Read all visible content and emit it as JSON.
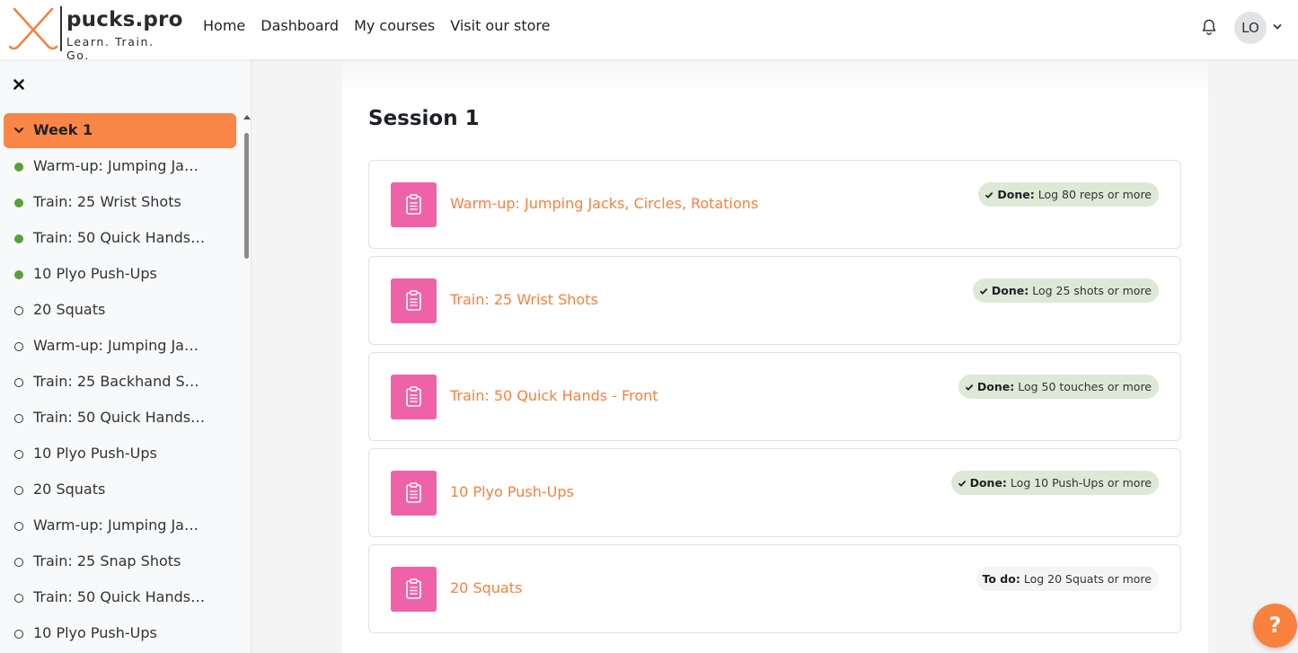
{
  "brand": {
    "name": "pucks.pro",
    "tagline": "Learn. Train. Go."
  },
  "nav": [
    "Home",
    "Dashboard",
    "My courses",
    "Visit our store"
  ],
  "user": {
    "initials": "LO"
  },
  "sidebar": {
    "section": "Week 1",
    "items": [
      {
        "label": "Warm-up: Jumping Jac...",
        "status": "done"
      },
      {
        "label": "Train: 25 Wrist Shots",
        "status": "done"
      },
      {
        "label": "Train: 50 Quick Hands - ...",
        "status": "done"
      },
      {
        "label": "10 Plyo Push-Ups",
        "status": "done"
      },
      {
        "label": "20 Squats",
        "status": "todo"
      },
      {
        "label": "Warm-up: Jumping Jac...",
        "status": "todo"
      },
      {
        "label": "Train: 25 Backhand Shot...",
        "status": "todo"
      },
      {
        "label": "Train: 50 Quick Hands - ...",
        "status": "todo"
      },
      {
        "label": "10 Plyo Push-Ups",
        "status": "todo"
      },
      {
        "label": "20 Squats",
        "status": "todo"
      },
      {
        "label": "Warm-up: Jumping Jac...",
        "status": "todo"
      },
      {
        "label": "Train: 25 Snap Shots",
        "status": "todo"
      },
      {
        "label": "Train: 50 Quick Hands - ...",
        "status": "todo"
      },
      {
        "label": "10 Plyo Push-Ups",
        "status": "todo"
      }
    ]
  },
  "main": {
    "title": "Session 1",
    "activities": [
      {
        "name": "Warm-up: Jumping Jacks, Circles, Rotations",
        "status": "done",
        "status_label": "Done:",
        "requirement": "Log 80 reps or more"
      },
      {
        "name": "Train: 25 Wrist Shots",
        "status": "done",
        "status_label": "Done:",
        "requirement": "Log 25 shots or more"
      },
      {
        "name": "Train: 50 Quick Hands - Front",
        "status": "done",
        "status_label": "Done:",
        "requirement": "Log 50 touches or more"
      },
      {
        "name": "10 Plyo Push-Ups",
        "status": "done",
        "status_label": "Done:",
        "requirement": "Log 10 Push-Ups or more"
      },
      {
        "name": "20 Squats",
        "status": "todo",
        "status_label": "To do:",
        "requirement": "Log 20 Squats or more"
      }
    ]
  },
  "help": {
    "label": "?"
  },
  "colors": {
    "accent": "#f7813d",
    "week_bg": "#f98547",
    "icon_bg": "#f062a8",
    "done_dot": "#5b9f3a",
    "done_badge": "#dde9d6"
  }
}
